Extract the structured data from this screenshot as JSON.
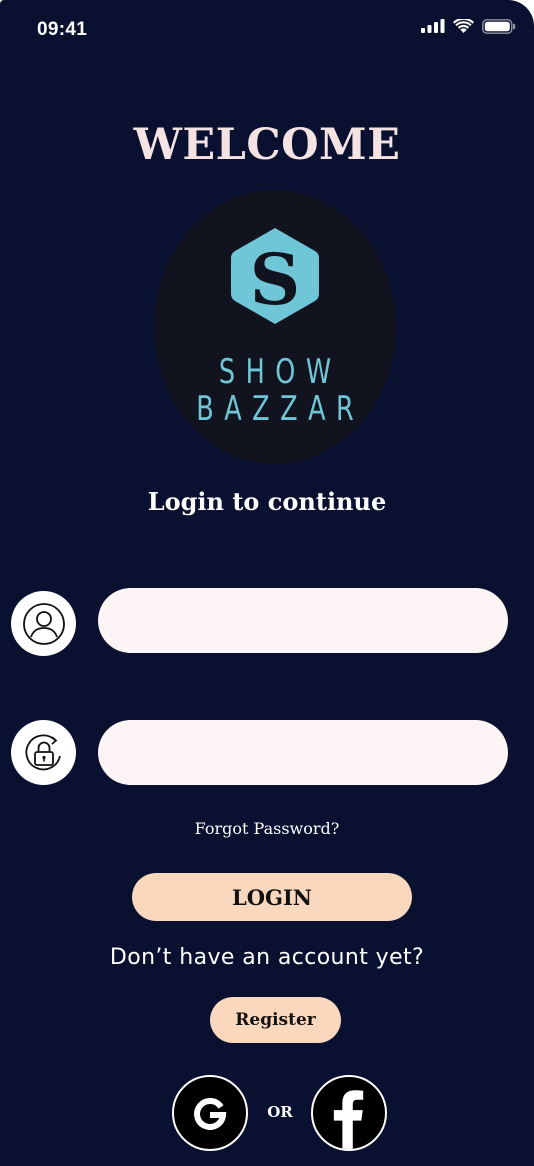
{
  "status_bar": {
    "time": "09:41",
    "icons": [
      "signal-icon",
      "wifi-icon",
      "battery-icon"
    ]
  },
  "header": {
    "welcome": "WELCOME"
  },
  "logo": {
    "letter": "S",
    "line1": "SHOW",
    "line2": "BAZZAR",
    "color": "#6fc6d6"
  },
  "subtitle": "Login to continue",
  "form": {
    "username_value": "",
    "password_value": "",
    "username_icon": "user-icon",
    "password_icon": "lock-refresh-icon",
    "forgot_label": "Forgot Password?",
    "login_label": "LOGIN"
  },
  "register_section": {
    "prompt": "Don’t have an account yet?",
    "register_label": "Register"
  },
  "social": {
    "or_label": "OR",
    "google_icon": "google-icon",
    "facebook_icon": "facebook-icon"
  },
  "colors": {
    "background": "#0a1030",
    "button": "#f9d8bd",
    "input": "#fdf5f5",
    "welcome": "#f5e2e2"
  }
}
